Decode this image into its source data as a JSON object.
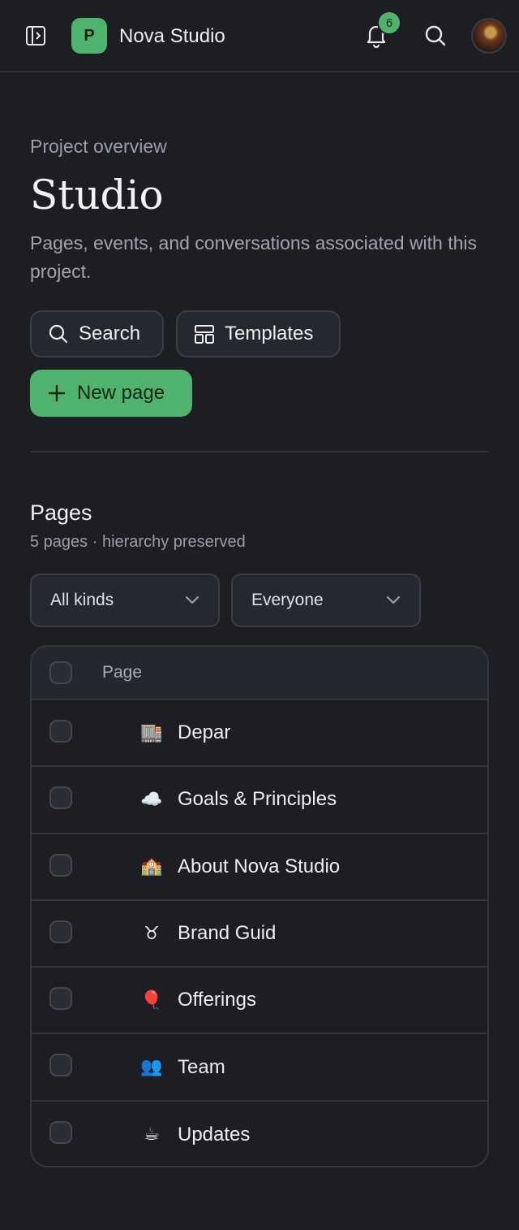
{
  "header": {
    "workspace_initial": "P",
    "workspace_name": "Nova Studio",
    "notification_count": "6"
  },
  "hero": {
    "eyebrow": "Project overview",
    "title": "Studio",
    "description": "Pages, events, and conversations associated with this project."
  },
  "actions": {
    "search_label": "Search",
    "templates_label": "Templates",
    "new_page_label": "New page"
  },
  "pages_section": {
    "title": "Pages",
    "subtitle": "5 pages · hierarchy preserved",
    "filter_kind": "All kinds",
    "filter_people": "Everyone",
    "column_header": "Page",
    "rows": [
      {
        "emoji": "🏬",
        "title": "Depar",
        "width": 95
      },
      {
        "emoji": "☁️",
        "title": "Goals & Principles",
        "width": 260
      },
      {
        "emoji": "🏫",
        "title": "About Nova Studio",
        "width": 260
      },
      {
        "emoji": "♉",
        "title": "Brand Guid",
        "width": 170
      },
      {
        "emoji": "🎈",
        "title": "Offerings",
        "width": 145
      },
      {
        "emoji": "👥",
        "title": "Team",
        "width": 200
      },
      {
        "emoji": "☕",
        "title": "Updates",
        "width": 200
      }
    ]
  },
  "colors": {
    "accent": "#4fb36d",
    "background": "#1c1e23",
    "surface": "#25282e"
  }
}
